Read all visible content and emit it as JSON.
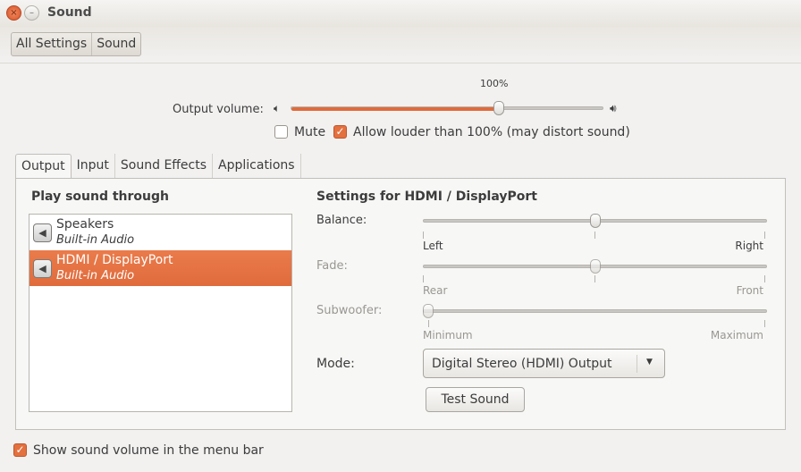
{
  "window": {
    "title": "Sound",
    "close_icon": "close-icon",
    "minimize_icon": "minimize-icon"
  },
  "breadcrumb": [
    "All Settings",
    "Sound"
  ],
  "volume": {
    "label": "Output volume:",
    "value_label": "100%",
    "value_percent": 100,
    "max_percent": 150,
    "low_icon": "speaker-low-icon",
    "high_icon": "speaker-high-icon"
  },
  "mute": {
    "label": "Mute",
    "checked": false
  },
  "allow_louder": {
    "label": "Allow louder than 100% (may distort sound)",
    "checked": true
  },
  "tabs": [
    {
      "label": "Output",
      "active": true
    },
    {
      "label": "Input"
    },
    {
      "label": "Sound Effects"
    },
    {
      "label": "Applications"
    }
  ],
  "output": {
    "list_title": "Play sound through",
    "devices": [
      {
        "name": "Speakers",
        "sub": "Built-in Audio",
        "selected": false
      },
      {
        "name": "HDMI / DisplayPort",
        "sub": "Built-in Audio",
        "selected": true
      }
    ],
    "settings_title": "Settings for HDMI / DisplayPort",
    "balance": {
      "label": "Balance:",
      "min": "Left",
      "max": "Right",
      "value": 0.5
    },
    "fade": {
      "label": "Fade:",
      "min": "Rear",
      "max": "Front",
      "value": 0.5,
      "disabled": true
    },
    "subwoofer": {
      "label": "Subwoofer:",
      "min": "Minimum",
      "max": "Maximum",
      "value": 0,
      "disabled": true
    },
    "mode": {
      "label": "Mode:",
      "value": "Digital Stereo (HDMI) Output"
    },
    "test_button": "Test Sound"
  },
  "show_volume": {
    "label": "Show sound volume in the menu bar",
    "checked": true
  },
  "colors": {
    "accent": "#e06b3c"
  }
}
